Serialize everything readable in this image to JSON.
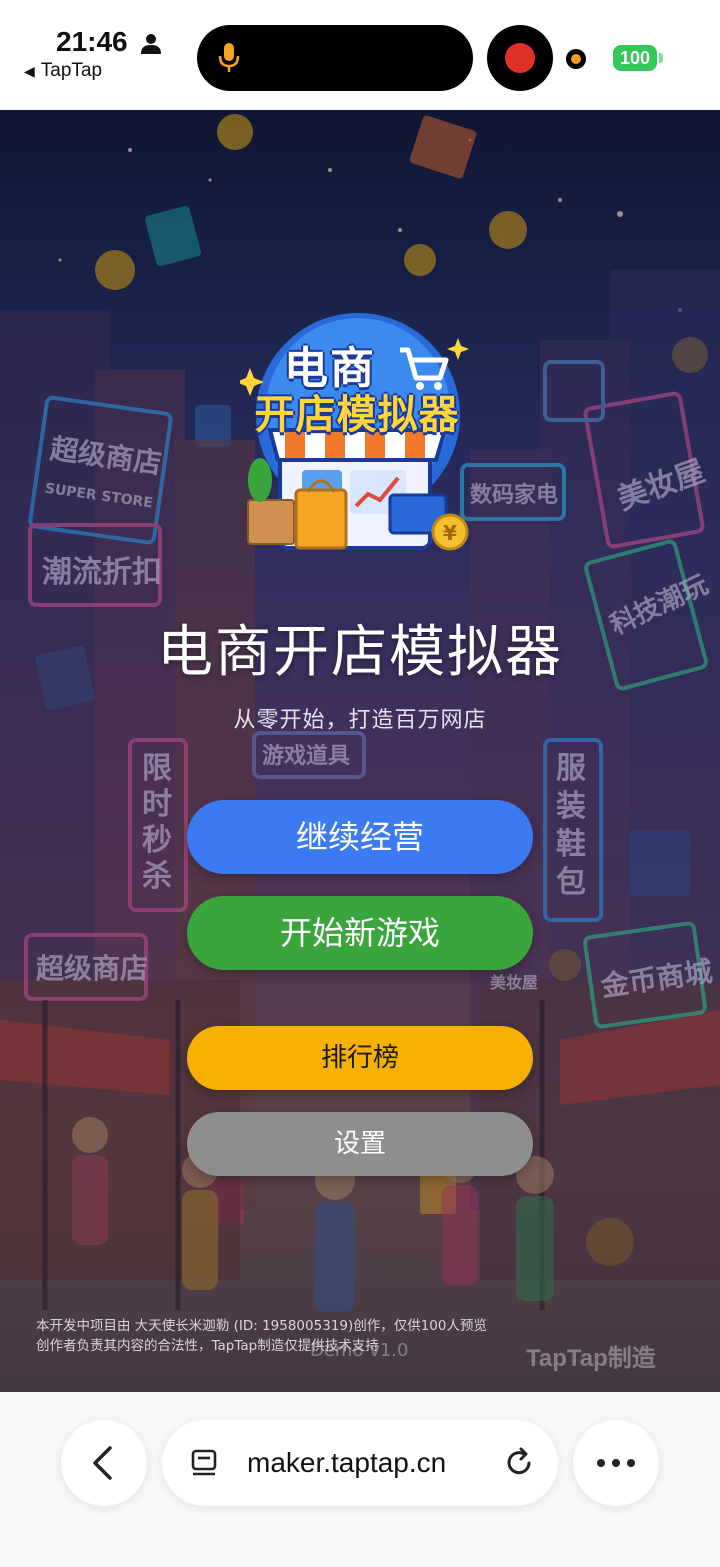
{
  "status_bar": {
    "time": "21:46",
    "back_app": "TapTap",
    "back_arrow": "◀",
    "battery": "100",
    "icons": [
      "person-icon",
      "mic-icon",
      "record-icon",
      "battery-icon"
    ]
  },
  "game": {
    "logo": {
      "line1": "电商",
      "line2": "开店模拟器"
    },
    "title": "电商开店模拟器",
    "subtitle": "从零开始，打造百万网店",
    "buttons": {
      "continue": "继续经营",
      "new_game": "开始新游戏",
      "leaderboard": "排行榜",
      "settings": "设置"
    },
    "disclaimer": {
      "line1": "本开发中项目由 大天使长米迦勒 (ID: 1958005319)创作，仅供100人预览",
      "line2": "创作者负责其内容的合法性，TapTap制造仅提供技术支持"
    },
    "version": "Demo v1.0",
    "watermark": "TapTap制造",
    "signs": [
      "超级商店",
      "SUPER STORE",
      "潮流折扣",
      "美妆屋",
      "数码家电",
      "科技潮玩",
      "游戏道具",
      "限时秒杀",
      "服装鞋包",
      "超级商店",
      "金币商城",
      "美妆屋"
    ]
  },
  "browser": {
    "url": "maker.taptap.cn",
    "icons": [
      "back-chevron-icon",
      "reader-icon",
      "reload-icon",
      "more-icon"
    ]
  },
  "colors": {
    "continue": "#3b7af0",
    "new_game": "#3aa53d",
    "leaderboard": "#f5b000",
    "settings": "#8e8e8e"
  }
}
